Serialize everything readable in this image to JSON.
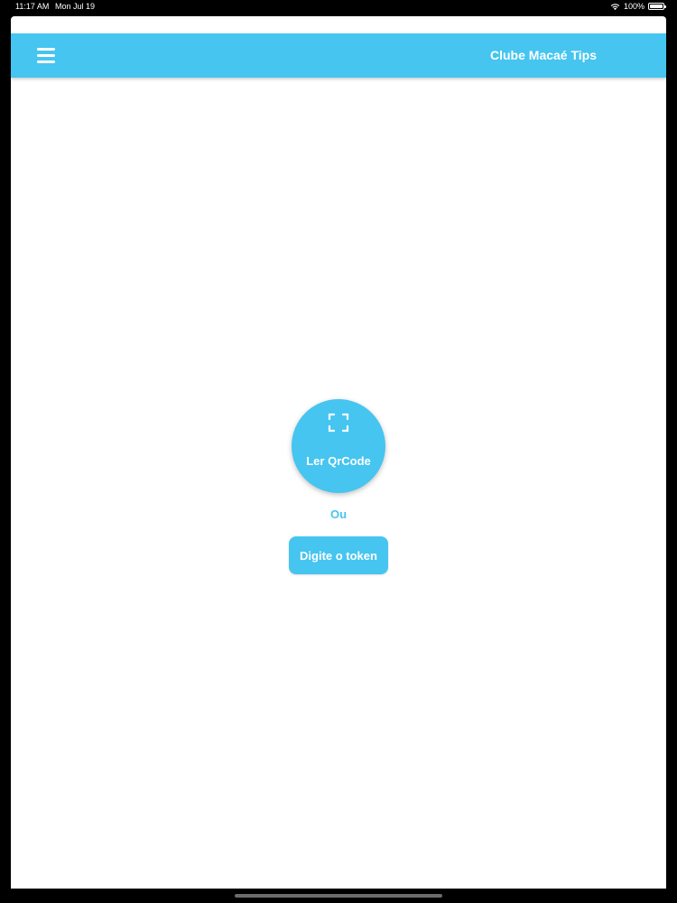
{
  "status_bar": {
    "time": "11:17 AM",
    "date": "Mon Jul 19",
    "battery": "100%"
  },
  "header": {
    "menu_icon": "hamburger-menu-icon",
    "title": "Clube Macaé Tips"
  },
  "main": {
    "qr_button": {
      "icon": "scan-frame-icon",
      "label": "Ler QrCode"
    },
    "or_label": "Ou",
    "token_button": {
      "label": "Digite o token"
    }
  },
  "colors": {
    "accent": "#45c5f0",
    "background": "#ffffff",
    "frame": "#000000"
  }
}
